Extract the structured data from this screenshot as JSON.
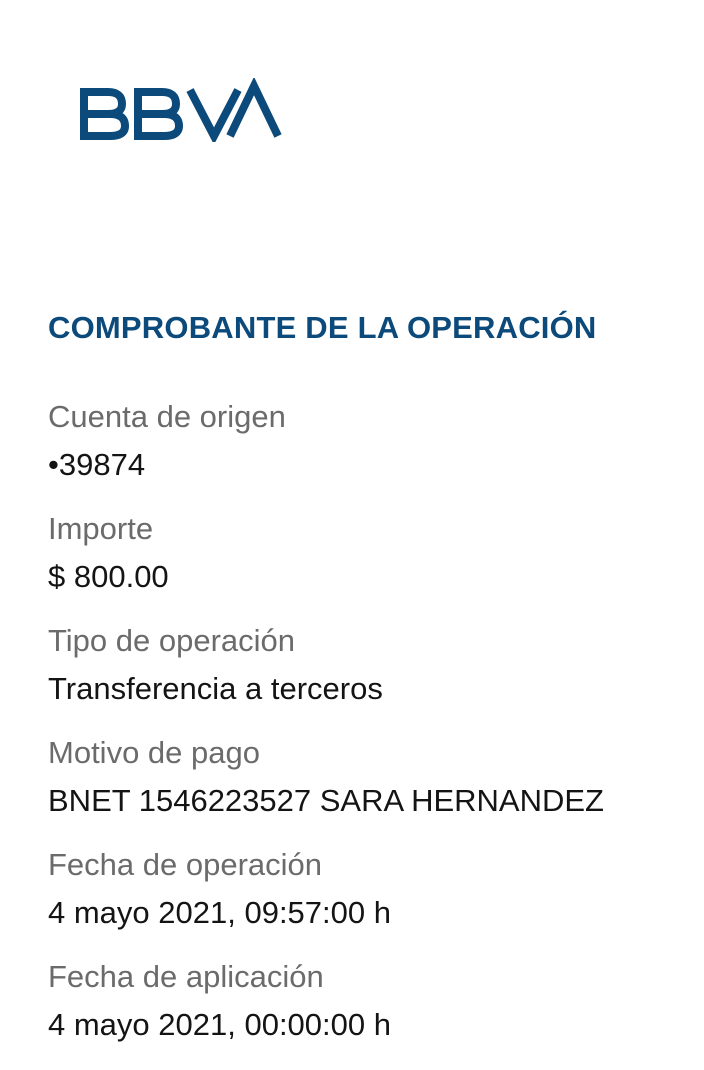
{
  "brand": {
    "logo_text": "BBVA",
    "color": "#0b4a7a"
  },
  "receipt": {
    "title": "COMPROBANTE DE LA OPERACIÓN",
    "fields": [
      {
        "label": "Cuenta de origen",
        "value": "•39874"
      },
      {
        "label": "Importe",
        "value": "$ 800.00"
      },
      {
        "label": "Tipo de operación",
        "value": "Transferencia a terceros"
      },
      {
        "label": "Motivo de pago",
        "value": "BNET 1546223527 SARA HERNANDEZ"
      },
      {
        "label": "Fecha de operación",
        "value": "4 mayo 2021, 09:57:00 h"
      },
      {
        "label": "Fecha de aplicación",
        "value": "4 mayo 2021, 00:00:00 h"
      }
    ]
  },
  "colors": {
    "label": "#6b6b6b",
    "value": "#141414",
    "title": "#0b4a7a"
  }
}
